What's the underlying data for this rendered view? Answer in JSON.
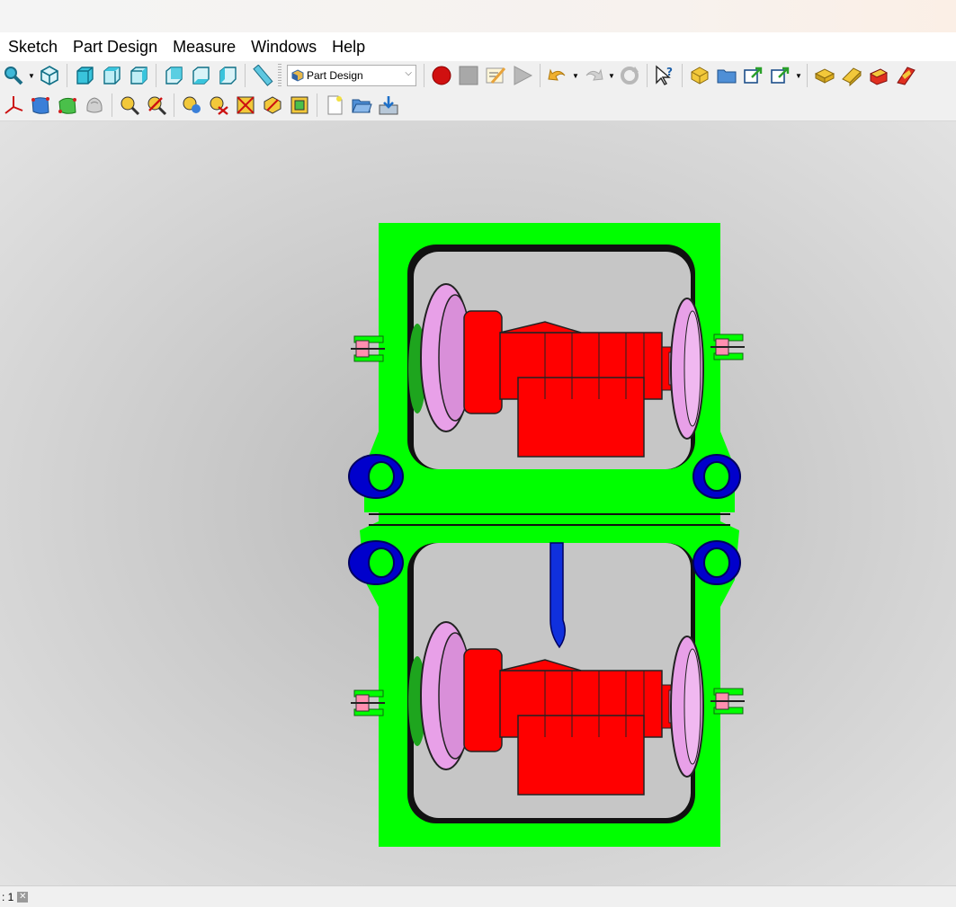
{
  "menubar": {
    "items": [
      "Sketch",
      "Part Design",
      "Measure",
      "Windows",
      "Help"
    ]
  },
  "toolbar": {
    "workbench_selected": "Part Design"
  },
  "statusbar": {
    "tab_label": ": 1"
  },
  "colors": {
    "frame": "#00ff00",
    "motor": "#ff0000",
    "wheel": "#e8a0e8",
    "spring": "#0000cc",
    "record": "#cc0000",
    "viewport_bg": "#c4c4c4"
  },
  "icons": {
    "toolbar1": [
      "zoom-icon",
      "view-isometric-icon",
      "view-front-icon",
      "view-top-icon",
      "view-right-icon",
      "view-rear-icon",
      "view-bottom-icon",
      "view-left-icon",
      "measure-ruler-icon",
      "macro-record-icon",
      "macro-stop-icon",
      "macro-edit-icon",
      "macro-play-icon",
      "undo-icon",
      "redo-icon",
      "refresh-icon",
      "whats-this-icon",
      "part-icon",
      "group-icon",
      "link-icon",
      "link-actions-icon",
      "pad-icon",
      "pocket-icon",
      "revolution-icon",
      "groove-icon"
    ],
    "toolbar2": [
      "axis-cross-icon",
      "shape-blue-icon",
      "shape-green-icon",
      "shape-gray-icon",
      "measure-linear-icon",
      "measure-angular-icon",
      "measure-refresh-icon",
      "measure-clear-icon",
      "measure-toggle-icon",
      "measure-3d-icon",
      "measure-delta-icon",
      "new-document-icon",
      "open-folder-icon",
      "save-document-icon"
    ]
  }
}
